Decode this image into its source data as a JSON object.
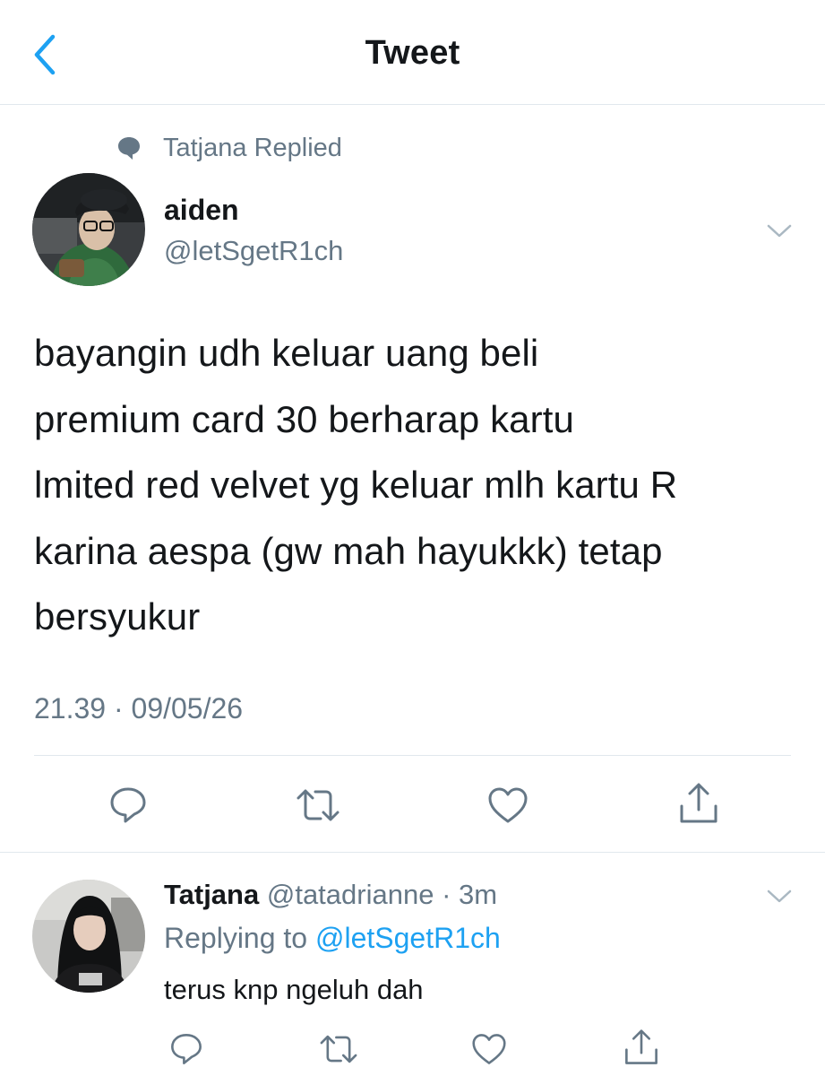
{
  "header": {
    "title": "Tweet",
    "back_icon": "chevron-left-icon"
  },
  "colors": {
    "accent": "#1da1f2",
    "text_primary": "#14171a",
    "text_secondary": "#657786",
    "divider": "#e1e8ed"
  },
  "replied_context": {
    "icon": "speech-bubble-icon",
    "text": "Tatjana Replied"
  },
  "tweet": {
    "author_name": "aiden",
    "author_handle": "@letSgetR1ch",
    "text_lines": [
      "bayangin udh keluar uang beli",
      "premium card 30 berharap kartu",
      "lmited red velvet yg keluar mlh kartu R",
      "karina aespa (gw mah hayukkk) tetap",
      "bersyukur"
    ],
    "timestamp": "21.39 · 09/05/26",
    "actions": [
      "reply-icon",
      "retweet-icon",
      "like-icon",
      "share-icon"
    ]
  },
  "reply": {
    "author_name": "Tatjana",
    "author_handle": "@tatadrianne",
    "separator": " · ",
    "time": "3m",
    "replying_to_label": "Replying to ",
    "replying_to_handle": "@letSgetR1ch",
    "text": "terus knp ngeluh dah",
    "actions": [
      "reply-icon",
      "retweet-icon",
      "like-icon",
      "share-icon"
    ]
  }
}
